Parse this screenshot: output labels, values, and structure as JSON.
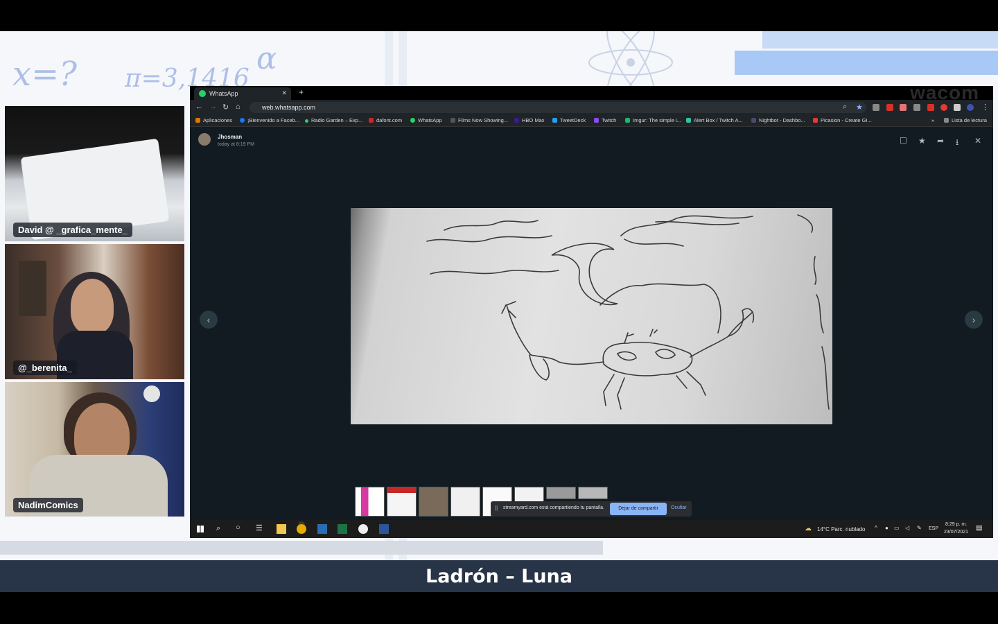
{
  "webcams": [
    {
      "name": "David @ _grafica_mente_"
    },
    {
      "name": "@_berenita_"
    },
    {
      "name": "NadimComics"
    }
  ],
  "background": {
    "formula_1": "x=?",
    "formula_2": "π=3,1416",
    "alpha": "α"
  },
  "browser": {
    "tab_title": "WhatsApp",
    "url": "web.whatsapp.com",
    "watermark": "wacom",
    "bookmarks": [
      "Aplicaciones",
      "¡Bienvenido a Faceb...",
      "Radio Garden – Exp...",
      "dafont.com",
      "WhatsApp",
      "Films Now Showing...",
      "HBO Max",
      "TweetDeck",
      "Twitch",
      "Imgur: The simple i...",
      "Alert Box / Twitch A...",
      "Nightbot - Dashbo...",
      "Picasion - Create GI..."
    ],
    "reading_list": "Lista de lectura"
  },
  "viewer": {
    "sender": "Jhosman",
    "sent_time": "today at 8:19 PM"
  },
  "share_notice": {
    "text": "streamyard.com está compartiendo tu pantalla.",
    "stop_label": "Dejar de compartir",
    "hide_label": "Ocultar"
  },
  "taskbar": {
    "weather": "14°C  Parc. nublado",
    "language": "ESP",
    "time": "8:29 p. m.",
    "date": "23/07/2021"
  },
  "caption": "Ladrón – Luna",
  "colors": {
    "caption_bar": "#283447",
    "whatsapp_bg": "#111b21",
    "share_button": "#8ab4f8",
    "accent_blue": "#a8c8f5"
  }
}
